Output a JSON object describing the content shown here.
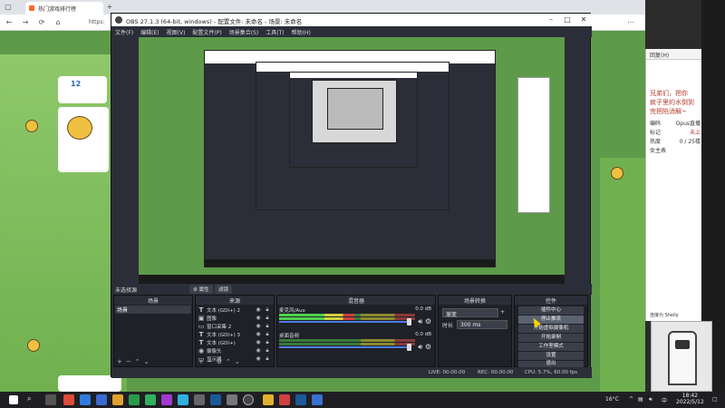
{
  "browser": {
    "tab_title": "热门游戏排行榜",
    "url_partial": "https:",
    "card_number": "12",
    "colors": {
      "accent": "#ff6b2b",
      "grass": "#5d9a49"
    }
  },
  "chat": {
    "head": "回复(H)",
    "message_lines": [
      "兄弟们，把你",
      "疯子里的水倒到",
      "完把陷消解~"
    ],
    "stats": [
      {
        "k": "编码",
        "v": "Opus直播"
      },
      {
        "k": "标记",
        "v": "未上"
      },
      {
        "k": "热度",
        "v": "0 / 25楼"
      },
      {
        "k": "女主表",
        "v": ""
      }
    ],
    "footer": "连接为 Shelly"
  },
  "obs": {
    "title": "OBS 27.1.3 (64-bit, windows) - 配置文件: 未命名 - 场景: 未命名",
    "menu": [
      "文件(F)",
      "编辑(E)",
      "视图(V)",
      "配置文件(P)",
      "场景集合(S)",
      "工具(T)",
      "帮助(H)"
    ],
    "scene_label": "未选择源",
    "properties_btn": "⚙ 属性",
    "filters_btn": "滤镜",
    "scenes": {
      "header": "场景",
      "items": [
        "场景"
      ]
    },
    "sources": {
      "header": "来源",
      "items": [
        {
          "icon": "T",
          "name": "文本 (GDI+) 2"
        },
        {
          "icon": "▣",
          "name": "图像"
        },
        {
          "icon": "▭",
          "name": "窗口采集 2"
        },
        {
          "icon": "T",
          "name": "文本 (GDI+) 3"
        },
        {
          "icon": "T",
          "name": "文本 (GDI+)"
        },
        {
          "icon": "◉",
          "name": "摄像头"
        },
        {
          "icon": "▭",
          "name": "显示器"
        }
      ]
    },
    "mixer": {
      "header": "混音器",
      "channels": [
        {
          "name": "麦克风/Aux",
          "db": "0.0 dB",
          "level": 0.55,
          "volume": 1.0
        },
        {
          "name": "桌面音频",
          "db": "0.0 dB",
          "level": 0.0,
          "volume": 1.0
        }
      ]
    },
    "transitions": {
      "header": "场景转换",
      "type": "渐变",
      "duration_label": "时长",
      "duration_value": "300 ms"
    },
    "controls": {
      "header": "控件",
      "buttons": [
        "插件中心",
        "停止推流",
        "开始虚拟摄像机",
        "开始录制",
        "工作室模式",
        "设置",
        "退出"
      ]
    },
    "status": {
      "live": "LIVE: 00:00:00",
      "rec": "REC: 00:00:00",
      "cpu": "CPU: 5.7%, 60.00 fps"
    }
  },
  "taskbar": {
    "weather": "16°C",
    "ime": "中",
    "time": "18:42",
    "date": "2022/5/12"
  }
}
